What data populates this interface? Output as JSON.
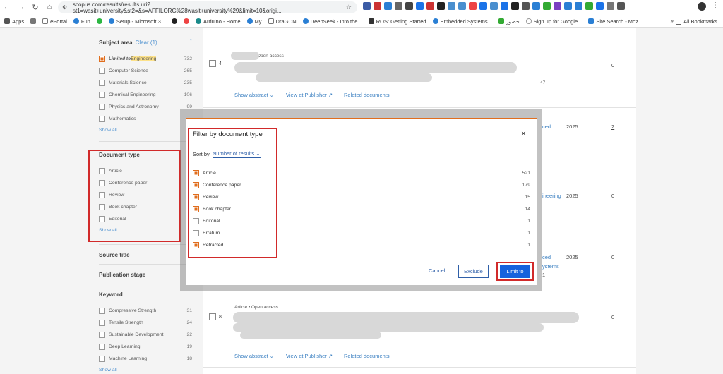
{
  "browser": {
    "url": "scopus.com/results/results.uri?st1=wasit+university&st2=&s=AFFILORG%28wasit+university%29&limit=10&origi...",
    "bookmarks": [
      "Apps",
      "ePortal",
      "Fun",
      "Setup - Microsoft 3...",
      "Arduino - Home",
      "My",
      "DraGON",
      "DeepSeek - Into the...",
      "ROS: Getting Started",
      "Embedded Systems...",
      "حضور",
      "Sign up for Google...",
      "Site Search - Moz"
    ],
    "all_bookmarks": "All Bookmarks",
    "more": "»"
  },
  "sidebar": {
    "subject_area": {
      "title": "Subject area",
      "clear": "Clear (1)",
      "items": [
        {
          "label_prefix": "Limited to ",
          "label": "Engineering",
          "count": "732",
          "checked": true
        },
        {
          "label": "Computer Science",
          "count": "265",
          "checked": false
        },
        {
          "label": "Materials Science",
          "count": "235",
          "checked": false
        },
        {
          "label": "Chemical Engineering",
          "count": "106",
          "checked": false
        },
        {
          "label": "Physics and Astronomy",
          "count": "99",
          "checked": false
        },
        {
          "label": "Mathematics",
          "count": "",
          "checked": false
        }
      ],
      "show_all": "Show all"
    },
    "document_type": {
      "title": "Document type",
      "items": [
        {
          "label": "Article"
        },
        {
          "label": "Conference paper"
        },
        {
          "label": "Review"
        },
        {
          "label": "Book chapter"
        },
        {
          "label": "Editorial"
        }
      ],
      "show_all": "Show all"
    },
    "source_title": "Source title",
    "publication_stage": "Publication stage",
    "keyword": {
      "title": "Keyword",
      "items": [
        {
          "label": "Compressive Strength",
          "count": "31"
        },
        {
          "label": "Tensile Strength",
          "count": "24"
        },
        {
          "label": "Sustainable Development",
          "count": "22"
        },
        {
          "label": "Deep Learning",
          "count": "19"
        },
        {
          "label": "Machine Learning",
          "count": "18"
        }
      ],
      "show_all": "Show all"
    }
  },
  "results": {
    "row4": {
      "num": "4",
      "meta": "Open access",
      "show_abstract": "Show abstract",
      "view_publisher": "View at Publisher",
      "related": "Related documents",
      "citations": "0",
      "suffix": "47"
    },
    "row5": {
      "year": "2025",
      "citations": "2",
      "frag": "ced"
    },
    "row6": {
      "year": "2025",
      "citations": "0",
      "frag": "ineering"
    },
    "row7": {
      "year": "2025",
      "citations": "0",
      "frag1": "ced",
      "frag2": "ystems",
      "frag3": "1"
    },
    "row8": {
      "num": "8",
      "meta": "Article  •  Open access",
      "show_abstract": "Show abstract",
      "view_publisher": "View at Publisher",
      "related": "Related documents",
      "citations": "0"
    }
  },
  "modal": {
    "title": "Filter by document type",
    "sort_by": "Sort by",
    "sort_value": "Number of results",
    "items": [
      {
        "label": "Article",
        "count": "521",
        "checked": true
      },
      {
        "label": "Conference paper",
        "count": "179",
        "checked": true
      },
      {
        "label": "Review",
        "count": "15",
        "checked": true
      },
      {
        "label": "Book chapter",
        "count": "14",
        "checked": true
      },
      {
        "label": "Editorial",
        "count": "1",
        "checked": false
      },
      {
        "label": "Erratum",
        "count": "1",
        "checked": false
      },
      {
        "label": "Retracted",
        "count": "1",
        "checked": true
      }
    ],
    "cancel": "Cancel",
    "exclude": "Exclude",
    "limit_to": "Limit to",
    "close": "×"
  },
  "colors": {
    "accent": "#e06e1e",
    "primary": "#1662dd",
    "highlight_box": "#d12a2a"
  }
}
